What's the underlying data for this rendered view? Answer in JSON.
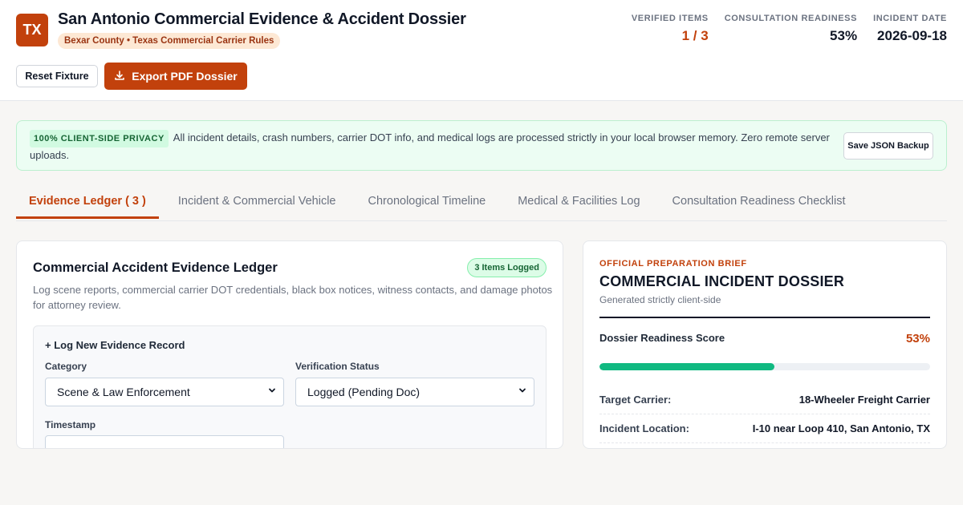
{
  "header": {
    "logo_text": "TX",
    "title": "San Antonio Commercial Evidence & Accident Dossier",
    "subtitle": "Bexar County • Texas Commercial Carrier Rules",
    "stats": [
      {
        "label": "VERIFIED ITEMS",
        "value": "1 / 3"
      },
      {
        "label": "CONSULTATION READINESS",
        "value": "53%"
      },
      {
        "label": "INCIDENT DATE",
        "value": "2026-09-18"
      }
    ],
    "reset_label": "Reset Fixture",
    "export_label": "Export PDF Dossier"
  },
  "privacy": {
    "badge": "100% CLIENT-SIDE PRIVACY",
    "text": "All incident details, crash numbers, carrier DOT info, and medical logs are processed strictly in your local browser memory. Zero remote server uploads.",
    "save_label": "Save JSON Backup"
  },
  "tabs": [
    {
      "label": "Evidence Ledger ( 3 )"
    },
    {
      "label": "Incident & Commercial Vehicle"
    },
    {
      "label": "Chronological Timeline"
    },
    {
      "label": "Medical & Facilities Log"
    },
    {
      "label": "Consultation Readiness Checklist"
    }
  ],
  "ledger": {
    "title": "Commercial Accident Evidence Ledger",
    "badge": "3 Items Logged",
    "description": "Log scene reports, commercial carrier DOT credentials, black box notices, witness contacts, and damage photos for attorney review.",
    "form_heading": "+ Log New Evidence Record",
    "category_label": "Category",
    "category_value": "Scene & Law Enforcement",
    "status_label": "Verification Status",
    "status_value": "Logged (Pending Doc)",
    "timestamp_label": "Timestamp"
  },
  "brief": {
    "kicker": "OFFICIAL PREPARATION BRIEF",
    "title": "COMMERCIAL INCIDENT DOSSIER",
    "subtitle": "Generated strictly client-side",
    "score_label": "Dossier Readiness Score",
    "score_value": "53%",
    "score_fraction": 0.53,
    "rows": [
      {
        "key": "Target Carrier:",
        "value": "18-Wheeler Freight Carrier"
      },
      {
        "key": "Incident Location:",
        "value": "I-10 near Loop 410, San Antonio, TX"
      }
    ]
  },
  "colors": {
    "brand": "#c2410c",
    "success": "#10b981"
  },
  "icons": {
    "export": "download-icon",
    "select": "chevron-down-icon"
  }
}
